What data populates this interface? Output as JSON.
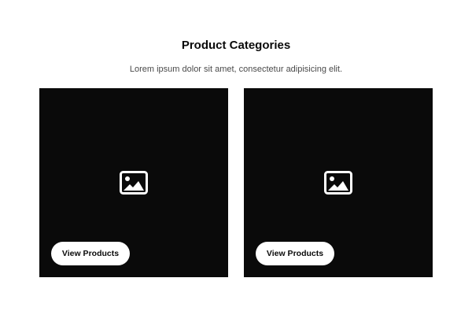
{
  "header": {
    "title": "Product Categories",
    "subtitle": "Lorem ipsum dolor sit amet, consectetur adipisicing elit."
  },
  "cards": [
    {
      "image_icon": "image-placeholder-icon",
      "button_label": "View Products"
    },
    {
      "image_icon": "image-placeholder-icon",
      "button_label": "View Products"
    }
  ],
  "colors": {
    "card_background": "#0a0a0a",
    "button_background": "#ffffff",
    "button_text": "#0a0a0a",
    "title_text": "#0a0a0a",
    "subtitle_text": "#4a4a4a"
  }
}
